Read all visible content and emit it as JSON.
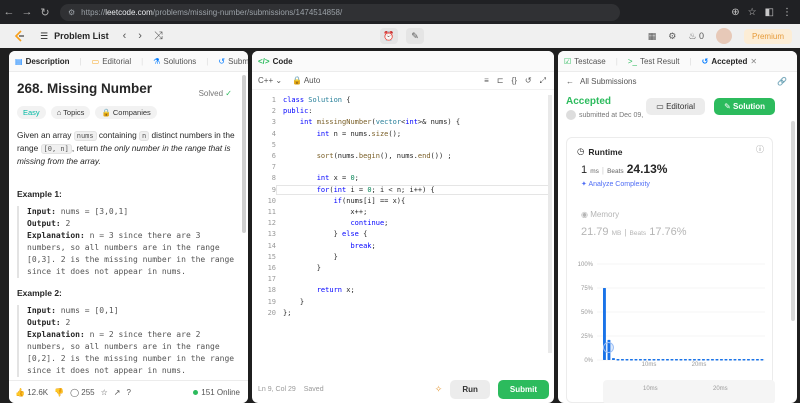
{
  "browser": {
    "url_prefix": "https://",
    "url_host": "leetcode.com",
    "url_path": "/problems/missing-number/submissions/1474514858/"
  },
  "header": {
    "problem_list": "Problem List",
    "streak": "0",
    "premium": "Premium"
  },
  "left_tabs": [
    "Description",
    "Editorial",
    "Solutions",
    "Submissions"
  ],
  "problem": {
    "title": "268. Missing Number",
    "solved": "Solved",
    "chips": [
      "Easy",
      "Topics",
      "Companies"
    ],
    "para_1": "Given an array ",
    "para_code_1": "nums",
    "para_2": " containing ",
    "para_code_2": "n",
    "para_3": " distinct numbers in the range ",
    "para_code_3": "[0, n]",
    "para_4": ", return ",
    "para_5": "the only number in the range that is missing from the array.",
    "examples": [
      {
        "title": "Example 1:",
        "input_label": "Input:",
        "input": " nums = [3,0,1]",
        "output_label": "Output:",
        "output": " 2",
        "expl_label": "Explanation:",
        "expl": " n = 3 since there are 3 numbers, so all numbers are in the range [0,3]. 2 is the missing number in the range since it does not appear in nums."
      },
      {
        "title": "Example 2:",
        "input_label": "Input:",
        "input": " nums = [0,1]",
        "output_label": "Output:",
        "output": " 2",
        "expl_label": "Explanation:",
        "expl": " n = 2 since there are 2 numbers, so all numbers are in the range [0,2]. 2 is the missing number in the range since it does not appear in nums."
      }
    ]
  },
  "left_footer": {
    "likes": "12.6K",
    "comments": "255",
    "online": "151 Online"
  },
  "code_tab": "Code",
  "code_bar": {
    "language": "C++",
    "mode": "Auto"
  },
  "code_lines": [
    "class Solution {",
    "public:",
    "    int missingNumber(vector<int>& nums) {",
    "        int n = nums.size();",
    "",
    "        sort(nums.begin(), nums.end()) ;",
    "",
    "        int x = 0;",
    "        for(int i = 0; i < n; i++) {",
    "            if(nums[i] == x){",
    "                x++;",
    "                continue;",
    "            } else {",
    "                break;",
    "            }",
    "        }",
    "",
    "        return x;",
    "    }",
    "};"
  ],
  "code_footer": {
    "position": "Ln 9, Col 29",
    "saved": "Saved",
    "run": "Run",
    "submit": "Submit"
  },
  "right_tabs": [
    "Testcase",
    "Test Result",
    "Accepted"
  ],
  "result": {
    "back": "All Submissions",
    "status": "Accepted",
    "submitted": "submitted at Dec 09,",
    "editorial": "Editorial",
    "solution": "Solution",
    "runtime_label": "Runtime",
    "runtime_value": "1",
    "runtime_unit": "ms",
    "runtime_beats_label": "Beats",
    "runtime_beats": "24.13%",
    "analyze": "Analyze Complexity",
    "memory_label": "Memory",
    "memory_value": "21.79",
    "memory_unit": "MB",
    "memory_beats_label": "Beats",
    "memory_beats": "17.76%"
  },
  "chart_data": {
    "type": "bar",
    "y_ticks": [
      "100%",
      "75%",
      "50%",
      "25%",
      "0%"
    ],
    "x_ticks": [
      "10ms",
      "20ms"
    ],
    "ylim": [
      0,
      100
    ],
    "x_unit": "ms",
    "bars": [
      {
        "x": 0,
        "y": 75,
        "highlight": true
      },
      {
        "x": 1,
        "y": 21
      },
      {
        "x": 2,
        "y": 2
      }
    ],
    "tail_level": 1,
    "user_point": {
      "x": 1,
      "y": 13
    },
    "lower_ticks": [
      "10ms",
      "20ms"
    ],
    "colors": {
      "bar": "#1a73e8",
      "accent": "#2cbb5d"
    }
  }
}
